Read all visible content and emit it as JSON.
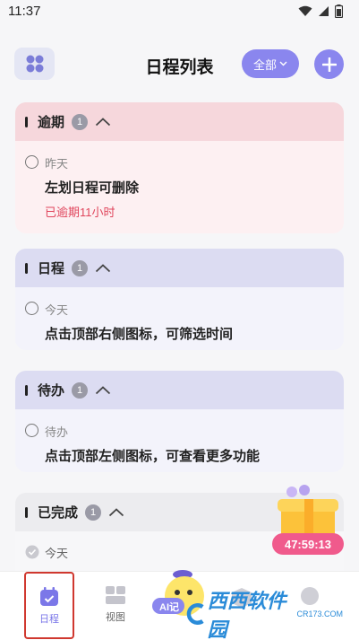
{
  "status": {
    "time": "11:37"
  },
  "header": {
    "title": "日程列表",
    "filter_label": "全部"
  },
  "sections": [
    {
      "title": "逾期",
      "count": "1",
      "item_date": "昨天",
      "item_task": "左划日程可删除",
      "item_note": "已逾期11小时"
    },
    {
      "title": "日程",
      "count": "1",
      "item_date": "今天",
      "item_task": "点击顶部右侧图标，可筛选时间"
    },
    {
      "title": "待办",
      "count": "1",
      "item_date": "待办",
      "item_task": "点击顶部左侧图标，可查看更多功能"
    },
    {
      "title": "已完成",
      "count": "1",
      "item_date": "今天"
    }
  ],
  "promo": {
    "timer": "47:59:13"
  },
  "mascot": {
    "label": "AI记"
  },
  "tabs": [
    {
      "label": "日程",
      "active": true
    },
    {
      "label": "视图",
      "active": false
    }
  ],
  "watermark": {
    "text": "西西软件园",
    "url": "CR173.COM"
  },
  "colors": {
    "accent": "#8a86ee",
    "overdue_red": "#e0455c",
    "timer_pink": "#f05a8c"
  }
}
